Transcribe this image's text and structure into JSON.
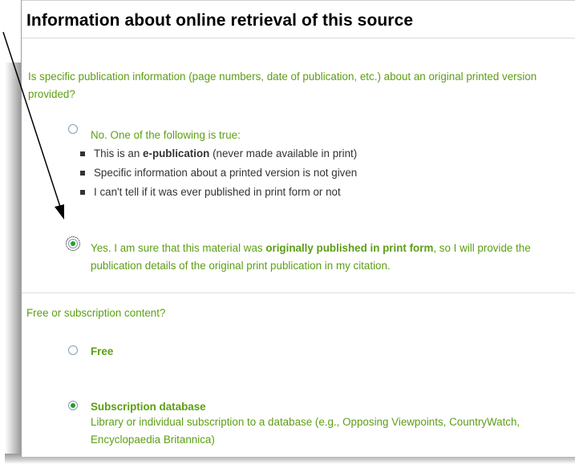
{
  "section": {
    "heading": "Information about online retrieval of this source"
  },
  "print_question": {
    "text": "Is specific publication information (page numbers, date of publication, etc.) about an original printed version provided?",
    "options": [
      {
        "label": "No. One of the following is true:",
        "selected": false,
        "bullets": [
          {
            "prefix": "This is an ",
            "bold": "e-publication",
            "suffix": " (never made available in print)"
          },
          {
            "prefix": "Specific information about a printed version is not given",
            "bold": "",
            "suffix": ""
          },
          {
            "prefix": "I can't tell if it was ever published in print form or not",
            "bold": "",
            "suffix": ""
          }
        ]
      },
      {
        "label_prefix": "Yes. I am sure that this material was ",
        "label_bold": "originally published in print form",
        "label_suffix": ", so I will provide the publication details of the original print publication in my citation.",
        "selected": true
      }
    ]
  },
  "content_question": {
    "text": "Free or subscription content?",
    "options": [
      {
        "label": "Free",
        "selected": false
      },
      {
        "label": "Subscription database",
        "selected": true,
        "description": "Library or individual subscription to a database (e.g., Opposing Viewpoints, CountryWatch, Encyclopaedia Britannica)"
      }
    ]
  },
  "colors": {
    "green_text": "#5d9e14",
    "radio_dot": "#21a121",
    "heading": "#000000"
  },
  "icons": [
    "radio-unchecked",
    "radio-checked",
    "square-bullet",
    "arrow"
  ]
}
